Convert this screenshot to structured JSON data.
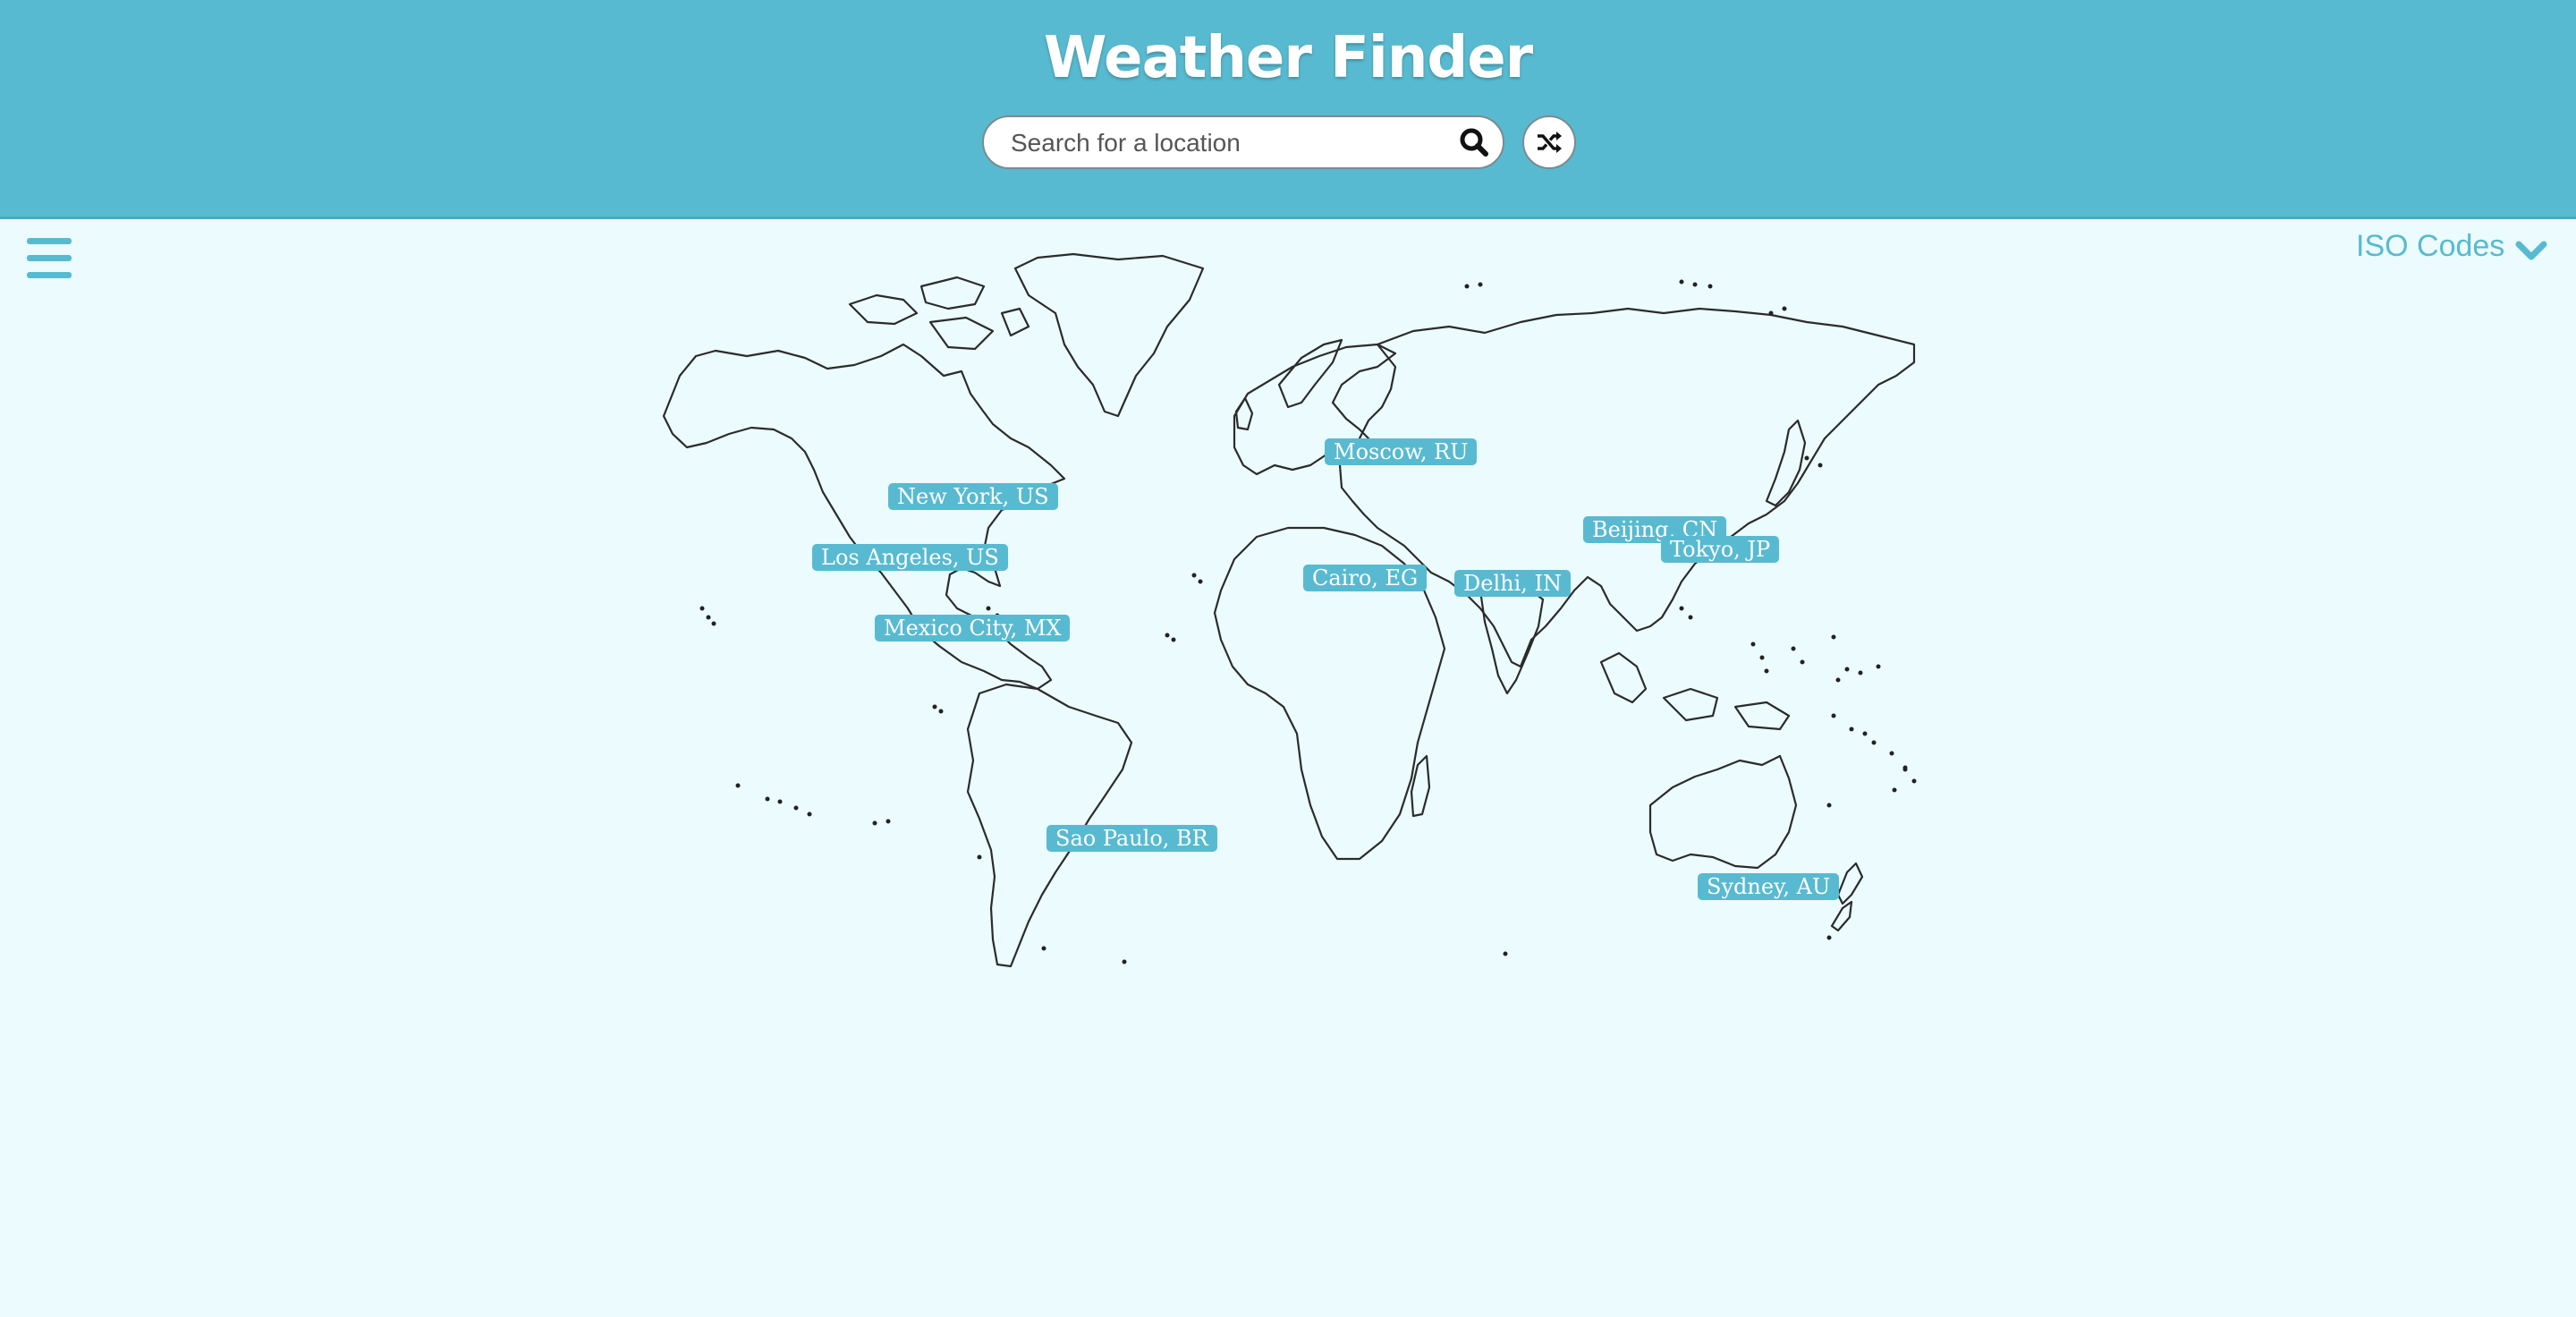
{
  "header": {
    "title": "Weather Finder",
    "search": {
      "placeholder": "Search for a location",
      "value": "",
      "icon": "search-icon"
    },
    "shuffle_icon": "shuffle-icon"
  },
  "menu": {
    "icon": "hamburger-menu-icon"
  },
  "iso_dropdown": {
    "label": "ISO Codes",
    "icon": "chevron-down-icon"
  },
  "map": {
    "cities": [
      {
        "label": "New York, US"
      },
      {
        "label": "Los Angeles, US"
      },
      {
        "label": "Mexico City, MX"
      },
      {
        "label": "Sao Paulo, BR"
      },
      {
        "label": "Moscow, RU"
      },
      {
        "label": "Cairo, EG"
      },
      {
        "label": "Delhi, IN"
      },
      {
        "label": "Beijing, CN"
      },
      {
        "label": "Tokyo, JP"
      },
      {
        "label": "Sydney, AU"
      }
    ]
  },
  "colors": {
    "header_bg": "#58bad0",
    "page_bg": "#ecfbfd",
    "accent": "#58bad0",
    "label_text": "#ffffff",
    "map_outline": "#222222"
  }
}
